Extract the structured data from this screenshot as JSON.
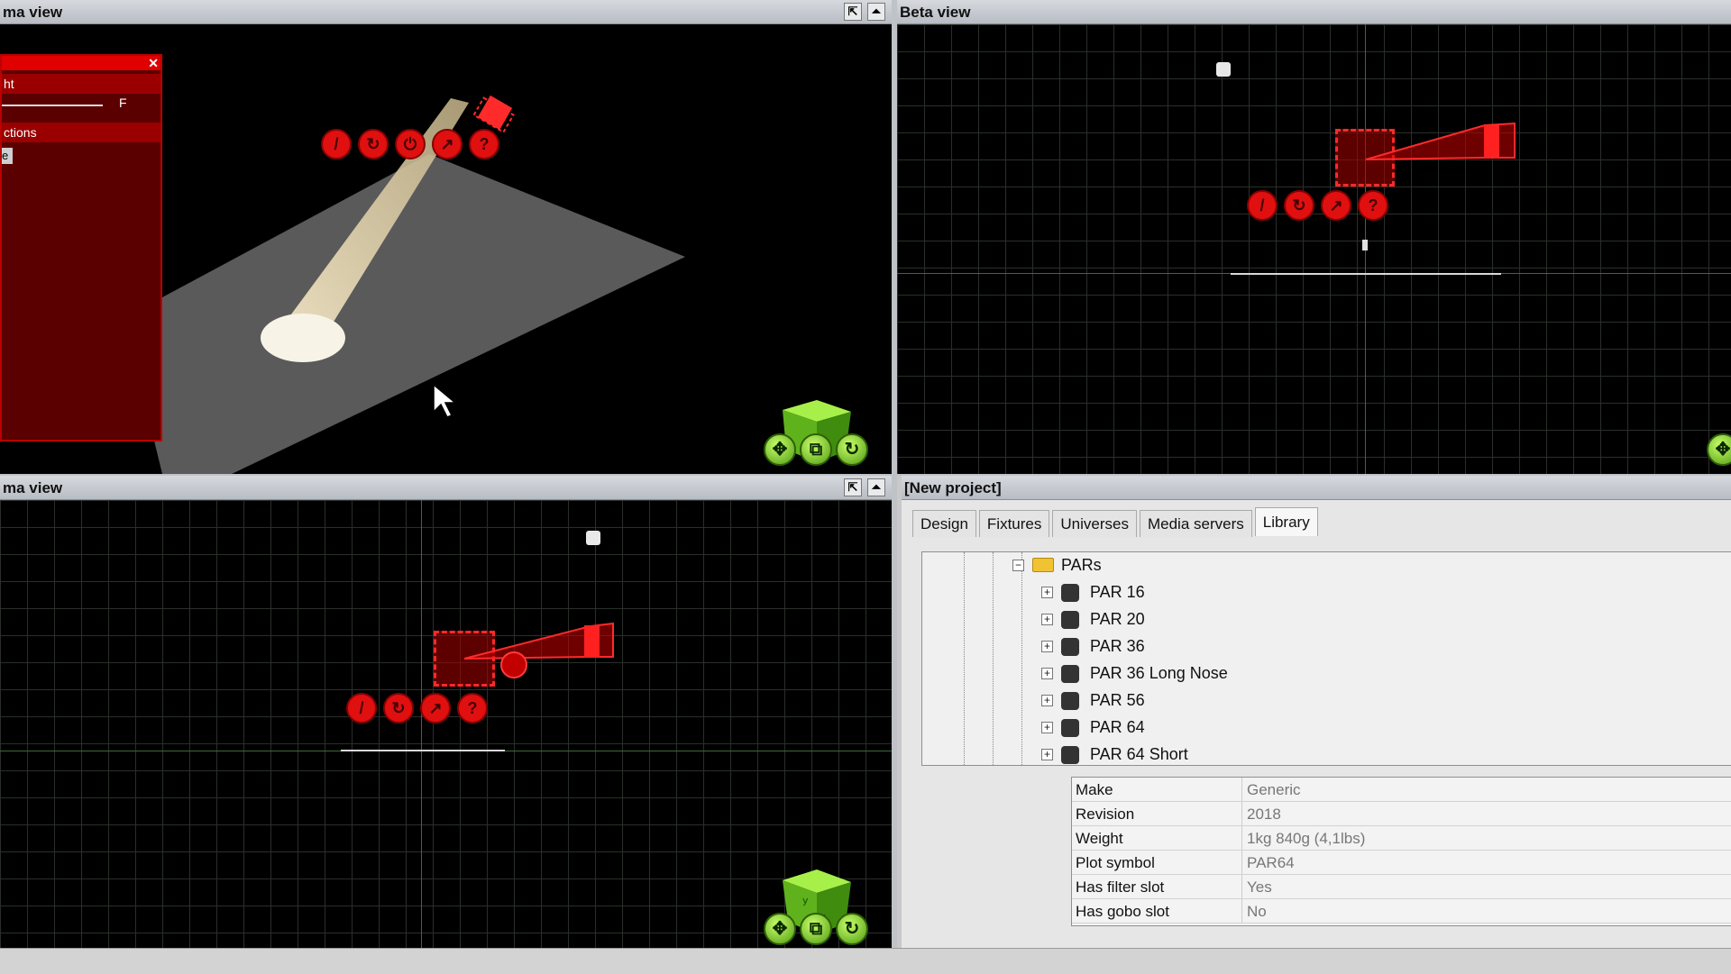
{
  "panels": {
    "top_left": {
      "title": "ma view"
    },
    "top_right": {
      "title": "Beta view"
    },
    "bottom_left": {
      "title": "ma view"
    },
    "bottom_right": {
      "title": "[New project]"
    }
  },
  "red_window": {
    "row1": "ht",
    "slider_label": "F",
    "row2": "ctions",
    "item": "e"
  },
  "fixture_controls": [
    "/",
    "↻",
    "⏻",
    "↗",
    "?"
  ],
  "tabs": [
    "Design",
    "Fixtures",
    "Universes",
    "Media servers",
    "Library"
  ],
  "active_tab": "Library",
  "tree": {
    "folder": "PARs",
    "items": [
      "PAR 16",
      "PAR 20",
      "PAR 36",
      "PAR 36 Long Nose",
      "PAR 56",
      "PAR 64",
      "PAR 64 Short"
    ]
  },
  "properties": [
    {
      "key": "Make",
      "value": "Generic"
    },
    {
      "key": "Revision",
      "value": "2018"
    },
    {
      "key": "Weight",
      "value": "1kg 840g (4,1lbs)"
    },
    {
      "key": "Plot symbol",
      "value": "PAR64"
    },
    {
      "key": "Has filter slot",
      "value": "Yes"
    },
    {
      "key": "Has gobo slot",
      "value": "No"
    }
  ],
  "colors": {
    "fixture_red": "#e01010",
    "nav_green": "#7fd12a",
    "title_bar": "#c8ccd2"
  }
}
